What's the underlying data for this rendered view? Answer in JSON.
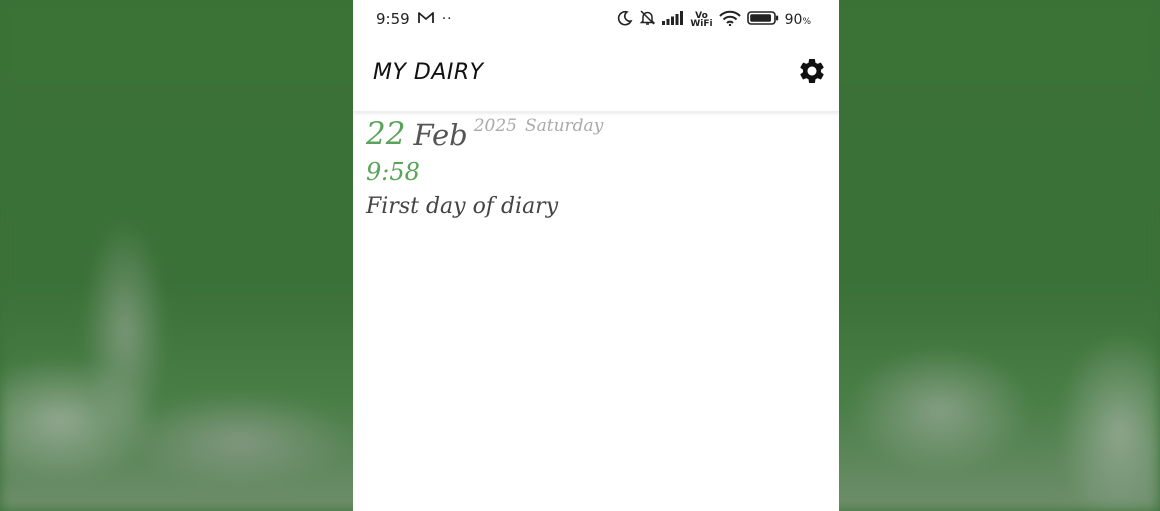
{
  "status_bar": {
    "time": "9:59",
    "dots": "··",
    "vo_wifi_top": "Vo",
    "vo_wifi_bottom": "WiFi",
    "battery_percent": "90",
    "battery_unit": "%",
    "icons": [
      "gmail-icon",
      "moon-icon",
      "bell-off-icon",
      "signal-icon",
      "vowifi-icon",
      "wifi-icon",
      "battery-icon"
    ]
  },
  "app_bar": {
    "title": "MY DAIRY",
    "settings_icon": "gear-icon"
  },
  "entry": {
    "day": "22",
    "month": "Feb",
    "year": "2025",
    "weekday": "Saturday",
    "time": "9:58",
    "text": "First day of diary"
  },
  "colors": {
    "accent_green": "#5aa35a",
    "background_green": "#3a7137",
    "month_text": "#555555",
    "muted_text": "#aaaaaa",
    "body_text": "#444444"
  }
}
